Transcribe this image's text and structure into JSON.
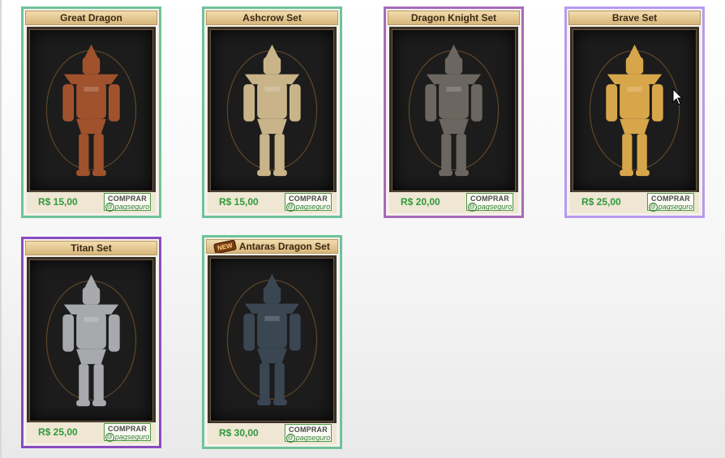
{
  "products": [
    {
      "name": "Great Dragon",
      "price": "R$ 15,00",
      "buy_label": "COMPRAR",
      "gateway_label": "pagseguro",
      "border_color": "#6fc39a",
      "armor_color": "#a0522d"
    },
    {
      "name": "Ashcrow Set",
      "price": "R$ 15,00",
      "buy_label": "COMPRAR",
      "gateway_label": "pagseguro",
      "border_color": "#6fc39a",
      "armor_color": "#c9b48a"
    },
    {
      "name": "Dragon Knight Set",
      "price": "R$ 20,00",
      "buy_label": "COMPRAR",
      "gateway_label": "pagseguro",
      "border_color": "#a76bb8",
      "armor_color": "#6c6660"
    },
    {
      "name": "Brave Set",
      "price": "R$ 25,00",
      "buy_label": "COMPRAR",
      "gateway_label": "pagseguro",
      "border_color": "#b79af0",
      "armor_color": "#d8a64a"
    },
    {
      "name": "Titan Set",
      "price": "R$ 25,00",
      "buy_label": "COMPRAR",
      "gateway_label": "pagseguro",
      "border_color": "#8a4cc0",
      "armor_color": "#a7a9ad"
    },
    {
      "name": "Antaras Dragon Set",
      "price": "R$ 30,00",
      "buy_label": "COMPRAR",
      "gateway_label": "pagseguro",
      "border_color": "#6fc39a",
      "armor_color": "#3a4652",
      "badge": "NEW"
    }
  ],
  "icons": {
    "payment": "pagseguro-at-icon",
    "cursor": "mouse-pointer-icon",
    "new": "new-badge-icon"
  }
}
